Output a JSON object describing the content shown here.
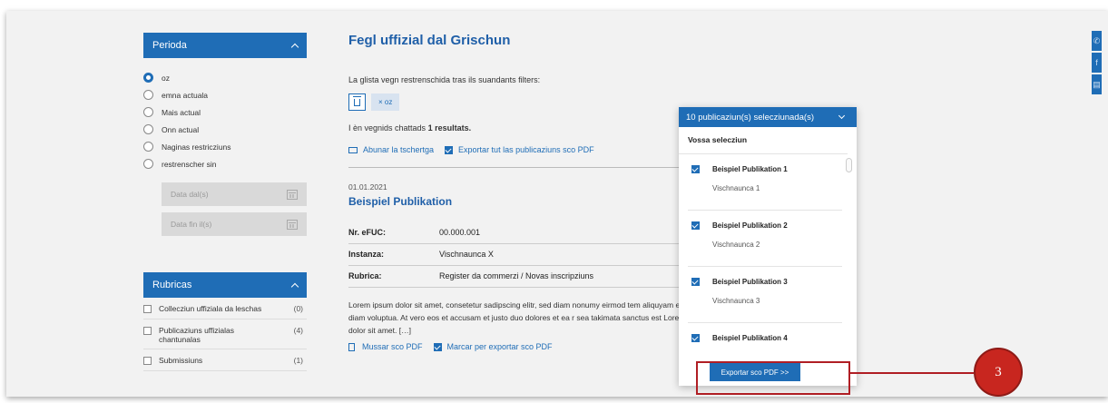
{
  "sidebar": {
    "periode": {
      "title": "Perioda",
      "options": [
        {
          "label": "oz",
          "selected": true
        },
        {
          "label": "emna actuala",
          "selected": false
        },
        {
          "label": "Mais actual",
          "selected": false
        },
        {
          "label": "Onn actual",
          "selected": false
        },
        {
          "label": "Naginas restricziuns",
          "selected": false
        },
        {
          "label": "restrenscher sin",
          "selected": false
        }
      ],
      "date_from_placeholder": "Data dal(s)",
      "date_to_placeholder": "Data fin il(s)"
    },
    "rubrics": {
      "title": "Rubricas",
      "items": [
        {
          "label": "Collecziun uffiziala da leschas",
          "count": "(0)"
        },
        {
          "label": "Publicaziuns uffizialas chantunalas",
          "count": "(4)"
        },
        {
          "label": "Submissiuns",
          "count": "(1)"
        }
      ]
    }
  },
  "main": {
    "title": "Fegl uffizial dal Grischun",
    "filter_text": "La glista vegn restrenschida tras ils suandants filters:",
    "filter_chip": "× oz",
    "results_prefix": "I èn vegnids chattads ",
    "results_bold": "1 resultats.",
    "subscribe_link": "Abunar la tschertga",
    "export_all_link": "Exportar tut las publicaziuns sco PDF",
    "publication": {
      "date": "01.01.2021",
      "title": "Beispiel Publikation",
      "rows": [
        {
          "key": "Nr. eFUC:",
          "value": "00.000.001"
        },
        {
          "key": "Instanza:",
          "value": "Vischnaunca X"
        },
        {
          "key": "Rubrica:",
          "value": "Register da commerzi / Novas inscripziuns"
        }
      ],
      "text": "Lorem ipsum dolor sit amet, consetetur sadipscing elitr, sed diam nonumy eirmod tem aliquyam erat, sed diam voluptua. At vero eos et accusam et justo duo dolores et ea r sea takimata sanctus est Lorem ipsum dolor sit amet. […]",
      "show_pdf": "Mussar sco PDF",
      "mark_pdf": "Marcar per exportar sco PDF"
    }
  },
  "popup": {
    "header": "10 publicaziun(s) selecziunada(s)",
    "subtitle": "Vossa selecziun",
    "items": [
      {
        "title": "Beispiel Publikation 1",
        "sub": "Vischnaunca 1"
      },
      {
        "title": "Beispiel Publikation 2",
        "sub": "Vischnaunca 2"
      },
      {
        "title": "Beispiel Publikation 3",
        "sub": "Vischnaunca 3"
      },
      {
        "title": "Beispiel Publikation 4",
        "sub": ""
      }
    ],
    "export_button": "Exportar sco PDF >>"
  },
  "annotation": {
    "number": "3"
  },
  "colors": {
    "accent": "#1f6db6",
    "title": "#1f5fa8",
    "annotation": "#c8261f"
  }
}
